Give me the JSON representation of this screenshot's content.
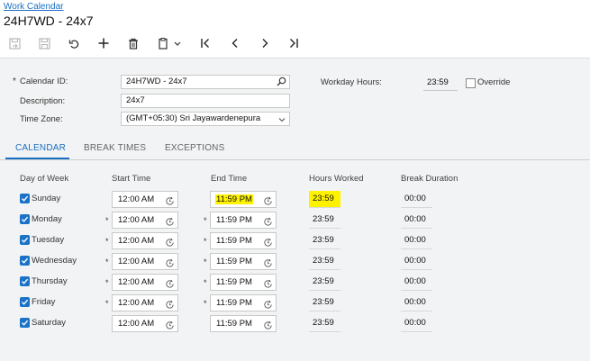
{
  "breadcrumb": "Work Calendar",
  "title": "24H7WD - 24x7",
  "toolbar": {
    "icons": [
      "save-and-close-icon",
      "save-icon",
      "undo-icon",
      "add-icon",
      "delete-icon",
      "copy-paste-icon",
      "first-icon",
      "previous-icon",
      "next-icon",
      "last-icon"
    ]
  },
  "form": {
    "calendar_id_label": "Calendar ID:",
    "calendar_id_value": "24H7WD - 24x7",
    "description_label": "Description:",
    "description_value": "24x7",
    "time_zone_label": "Time Zone:",
    "time_zone_value": "(GMT+05:30) Sri Jayawardenepura",
    "workday_hours_label": "Workday Hours:",
    "workday_hours_value": "23:59",
    "override_label": "Override",
    "override_checked": false,
    "required_mark": "*"
  },
  "tabs": [
    {
      "label": "CALENDAR",
      "active": true
    },
    {
      "label": "BREAK TIMES",
      "active": false
    },
    {
      "label": "EXCEPTIONS",
      "active": false
    }
  ],
  "grid": {
    "headers": {
      "day": "Day of Week",
      "start": "Start Time",
      "end": "End Time",
      "hours": "Hours Worked",
      "break": "Break Duration"
    },
    "required_mark": "*",
    "rows": [
      {
        "day": "Sunday",
        "checked": true,
        "start": "12:00 AM",
        "end": "11:59 PM",
        "hours": "23:59",
        "break": "00:00"
      },
      {
        "day": "Monday",
        "checked": true,
        "start": "12:00 AM",
        "end": "11:59 PM",
        "hours": "23:59",
        "break": "00:00"
      },
      {
        "day": "Tuesday",
        "checked": true,
        "start": "12:00 AM",
        "end": "11:59 PM",
        "hours": "23:59",
        "break": "00:00"
      },
      {
        "day": "Wednesday",
        "checked": true,
        "start": "12:00 AM",
        "end": "11:59 PM",
        "hours": "23:59",
        "break": "00:00"
      },
      {
        "day": "Thursday",
        "checked": true,
        "start": "12:00 AM",
        "end": "11:59 PM",
        "hours": "23:59",
        "break": "00:00"
      },
      {
        "day": "Friday",
        "checked": true,
        "start": "12:00 AM",
        "end": "11:59 PM",
        "hours": "23:59",
        "break": "00:00"
      },
      {
        "day": "Saturday",
        "checked": true,
        "start": "12:00 AM",
        "end": "11:59 PM",
        "hours": "23:59",
        "break": "00:00"
      }
    ]
  },
  "colors": {
    "accent": "#1a6fc4",
    "highlight": "#fff200",
    "panel": "#f2f3f4"
  }
}
